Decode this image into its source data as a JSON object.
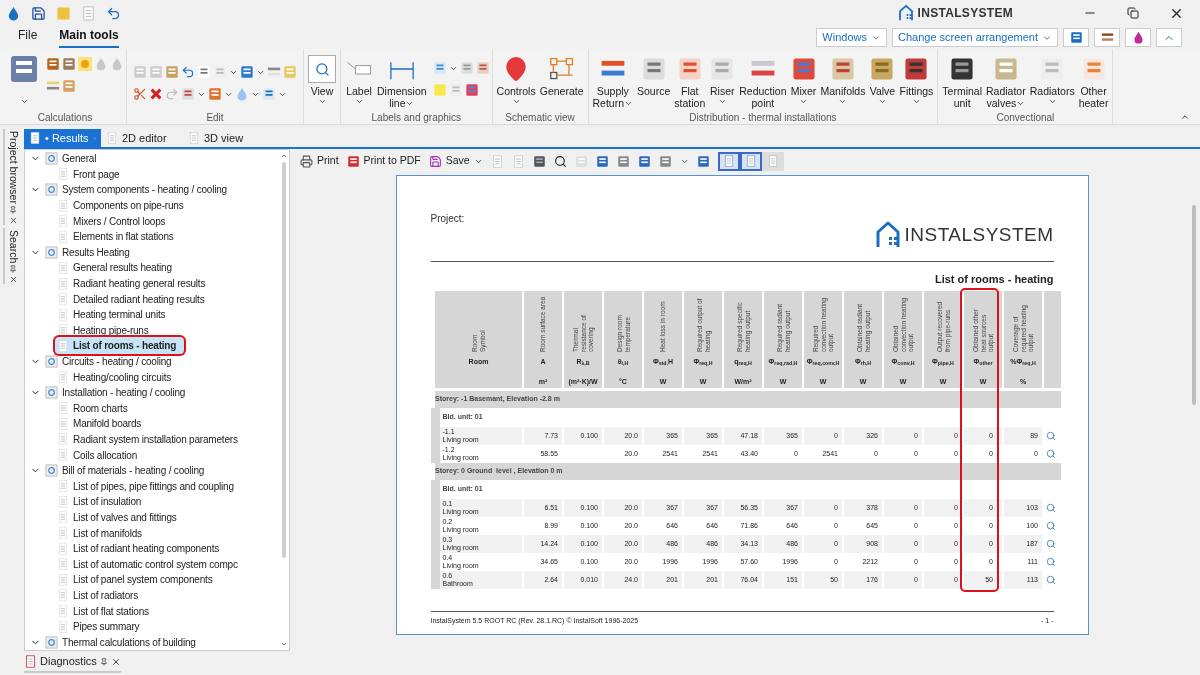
{
  "title_bar": {
    "logo": "INSTALSYSTEM"
  },
  "menu_tabs": [
    {
      "label": "File",
      "selected": false
    },
    {
      "label": "Main tools",
      "selected": true
    }
  ],
  "top_right": {
    "dropdowns": [
      "Windows",
      "Change screen arrangement"
    ]
  },
  "ribbon_groups": [
    {
      "label": "Calculations",
      "buttons": [
        {
          "dropdown": true
        }
      ]
    },
    {
      "label": "Edit"
    },
    {
      "buttons": [
        {
          "lines": [
            "View"
          ],
          "dropdown": true
        }
      ]
    },
    {
      "label": "Labels and graphics",
      "buttons": [
        {
          "lines": [
            "Label"
          ],
          "dropdown": true
        },
        {
          "lines": [
            "Dimension",
            "line"
          ],
          "dropdown": true,
          "caret_beside_text": true
        }
      ]
    },
    {
      "label": "Schematic view",
      "buttons": [
        {
          "lines": [
            "Controls"
          ],
          "dropdown": true
        },
        {
          "lines": [
            "Generate"
          ]
        }
      ]
    },
    {
      "label": "Distribution - thermal installations",
      "buttons": [
        {
          "lines": [
            "Supply",
            "Return"
          ],
          "dropdown": true,
          "caret_beside_text": true
        },
        {
          "lines": [
            "Source"
          ]
        },
        {
          "lines": [
            "Flat",
            "station"
          ]
        },
        {
          "lines": [
            "Riser"
          ],
          "dropdown": true
        },
        {
          "lines": [
            "Reduction",
            "point"
          ]
        },
        {
          "lines": [
            "Mixer"
          ],
          "dropdown": true
        },
        {
          "lines": [
            "Manifolds"
          ],
          "dropdown": true
        },
        {
          "lines": [
            "Valve"
          ],
          "dropdown": true
        },
        {
          "lines": [
            "Fittings"
          ],
          "dropdown": true
        }
      ]
    },
    {
      "label": "Convectional",
      "buttons": [
        {
          "lines": [
            "Terminal",
            "unit"
          ]
        },
        {
          "lines": [
            "Radiator",
            "valves"
          ],
          "dropdown": true,
          "caret_beside_text": true
        },
        {
          "lines": [
            "Radiators"
          ],
          "dropdown": true
        },
        {
          "lines": [
            "Other",
            "heater"
          ]
        }
      ]
    }
  ],
  "side_panels": [
    "Project browser",
    "Search"
  ],
  "doc_tabs": [
    {
      "label": "• Results",
      "selected": true
    },
    {
      "label": "2D editor",
      "selected": false
    },
    {
      "label": "3D view",
      "selected": false
    }
  ],
  "tree": [
    {
      "label": "General",
      "expanded": true,
      "children": [
        {
          "label": "Front page",
          "selected": false,
          "marked": false
        }
      ]
    },
    {
      "label": "System components - heating / cooling",
      "expanded": true,
      "children": [
        {
          "label": "Components on pipe-runs",
          "selected": false,
          "marked": false
        },
        {
          "label": "Mixers / Control loops",
          "selected": false,
          "marked": false
        },
        {
          "label": "Elements in flat stations",
          "selected": false,
          "marked": false
        }
      ]
    },
    {
      "label": "Results Heating",
      "expanded": true,
      "children": [
        {
          "label": "General results heating",
          "selected": false,
          "marked": false
        },
        {
          "label": "Radiant heating general results",
          "selected": false,
          "marked": false
        },
        {
          "label": "Detailed radiant heating results",
          "selected": false,
          "marked": false
        },
        {
          "label": "Heating terminal units",
          "selected": false,
          "marked": false
        },
        {
          "label": "Heating pipe-runs",
          "selected": false,
          "marked": false
        },
        {
          "label": "List of rooms - heating",
          "selected": true,
          "marked": true
        }
      ]
    },
    {
      "label": "Circuits - heating / cooling",
      "expanded": true,
      "children": [
        {
          "label": "Heating/cooling circuits",
          "selected": false,
          "marked": false
        }
      ]
    },
    {
      "label": "Installation - heating / cooling",
      "expanded": true,
      "children": [
        {
          "label": "Room charts",
          "selected": false,
          "marked": false
        },
        {
          "label": "Manifold boards",
          "selected": false,
          "marked": false
        },
        {
          "label": "Radiant system installation parameters",
          "selected": false,
          "marked": false
        },
        {
          "label": "Coils allocation",
          "selected": false,
          "marked": false
        }
      ]
    },
    {
      "label": "Bill of materials - heating / cooling",
      "expanded": true,
      "children": [
        {
          "label": "List of pipes, pipe fittings and coupling",
          "selected": false,
          "marked": false
        },
        {
          "label": "List of insulation",
          "selected": false,
          "marked": false
        },
        {
          "label": "List of valves and fittings",
          "selected": false,
          "marked": false
        },
        {
          "label": "List of manifolds",
          "selected": false,
          "marked": false
        },
        {
          "label": "List of radiant heating components",
          "selected": false,
          "marked": false
        },
        {
          "label": "List of automatic control system compc",
          "selected": false,
          "marked": false
        },
        {
          "label": "List of panel system components",
          "selected": false,
          "marked": false
        },
        {
          "label": "List of radiators",
          "selected": false,
          "marked": false
        },
        {
          "label": "List of flat stations",
          "selected": false,
          "marked": false
        },
        {
          "label": "Pipes summary",
          "selected": false,
          "marked": false
        }
      ]
    },
    {
      "label": "Thermal calculations of building",
      "expanded": true
    }
  ],
  "toolbar": {
    "buttons": [
      {
        "label": "Print"
      },
      {
        "label": "Print to PDF"
      },
      {
        "label": "Save",
        "dropdown": true
      }
    ],
    "page_view_buttons": [
      {
        "selected": true
      },
      {
        "selected": true
      },
      {
        "selected": false
      }
    ]
  },
  "report": {
    "project_label": "Project:",
    "logo": "INSTALSYSTEM",
    "title": "List of rooms - heating",
    "columns": [
      {
        "header": [
          "Room",
          "Symbol"
        ],
        "symbol": "Room",
        "highlighted": false
      },
      {
        "header": [
          "Room surface area"
        ],
        "symbol": "A",
        "unit": "m²",
        "highlighted": false
      },
      {
        "header": [
          "Thermal",
          "resistance of",
          "covering"
        ],
        "symbol": "R$_{λ,B}$",
        "unit": "(m²·K)/W",
        "highlighted": false
      },
      {
        "header": [
          "Design room",
          "temperature"
        ],
        "symbol": "θ$_{i,H}$",
        "unit": "°C",
        "highlighted": false
      },
      {
        "header": [
          "Heat loss in room"
        ],
        "symbol": "Φ$_{std,}$H",
        "unit": "W",
        "highlighted": false
      },
      {
        "header": [
          "Required output of",
          "heating"
        ],
        "symbol": "Φ$_{req,H}$",
        "unit": "W",
        "highlighted": false
      },
      {
        "header": [
          "Required specific",
          "heating output"
        ],
        "symbol": "q$_{req,H}$",
        "unit": "W/m²",
        "highlighted": false
      },
      {
        "header": [
          "Required radiant",
          "heating output"
        ],
        "symbol": "Φ$_{req,rad,H}$",
        "unit": "W",
        "highlighted": false
      },
      {
        "header": [
          "Required",
          "convection heating",
          "output"
        ],
        "symbol": "Φ$_{req,conv,H}$",
        "unit": "W",
        "highlighted": false
      },
      {
        "header": [
          "Obtained radiant",
          "heating output"
        ],
        "symbol": "Φ$_{rh,H}$",
        "unit": "W",
        "highlighted": false
      },
      {
        "header": [
          "Obtained",
          "convection heating",
          "output"
        ],
        "symbol": "Φ$_{conv,H}$",
        "unit": "W",
        "highlighted": false
      },
      {
        "header": [
          "Output recovered",
          "from pipe-runs"
        ],
        "symbol": "Φ$_{pipe,H}$",
        "unit": "W",
        "highlighted": false
      },
      {
        "header": [
          "Obtained other",
          "heat sources",
          "output"
        ],
        "symbol": "Φ$_{other}$",
        "unit": "W",
        "highlighted": true
      },
      {
        "header": [
          "Coverage of",
          "required heating",
          "output"
        ],
        "symbol": "%Φ$_{req,H}$",
        "unit": "%",
        "highlighted": false
      }
    ],
    "sections": [
      {
        "storey": "Storey: -1 Basemant, Elevation -2.8 m",
        "units": [
          {
            "label": "Bld. unit: 01",
            "rows": [
              {
                "symbol": "-1.1",
                "name": "Living room",
                "area": "7.73",
                "resistance": "0.100",
                "temperature": "20.0",
                "heat_loss": "365",
                "required": "365",
                "specific": "47.18",
                "required_radiant": "365",
                "required_convection": "0",
                "obtained_radiant": "326",
                "obtained_convection": "0",
                "recovered": "0",
                "other": "0",
                "coverage": "89"
              },
              {
                "symbol": "-1.2",
                "name": "Living room",
                "area": "58.55",
                "temperature": "20.0",
                "heat_loss": "2541",
                "required": "2541",
                "specific": "43.40",
                "required_radiant": "0",
                "required_convection": "2541",
                "obtained_radiant": "0",
                "obtained_convection": "0",
                "recovered": "0",
                "other": "0",
                "coverage": "0"
              }
            ]
          }
        ]
      },
      {
        "storey": "Storey: 0 Ground  level , Elevation 0 m",
        "units": [
          {
            "label": "Bld. unit: 01",
            "rows": [
              {
                "symbol": "0.1",
                "name": "Living room",
                "area": "6.51",
                "resistance": "0.100",
                "temperature": "20.0",
                "heat_loss": "367",
                "required": "367",
                "specific": "56.35",
                "required_radiant": "367",
                "required_convection": "0",
                "obtained_radiant": "378",
                "obtained_convection": "0",
                "recovered": "0",
                "other": "0",
                "coverage": "103"
              },
              {
                "symbol": "0.2",
                "name": "Living room",
                "area": "8.99",
                "resistance": "0.100",
                "temperature": "20.0",
                "heat_loss": "646",
                "required": "646",
                "specific": "71.86",
                "required_radiant": "646",
                "required_convection": "0",
                "obtained_radiant": "645",
                "obtained_convection": "0",
                "recovered": "0",
                "other": "0",
                "coverage": "100"
              },
              {
                "symbol": "0.3",
                "name": "Living room",
                "area": "14.24",
                "resistance": "0.100",
                "temperature": "20.0",
                "heat_loss": "486",
                "required": "486",
                "specific": "34.13",
                "required_radiant": "486",
                "required_convection": "0",
                "obtained_radiant": "908",
                "obtained_convection": "0",
                "recovered": "0",
                "other": "0",
                "coverage": "187"
              },
              {
                "symbol": "0.4",
                "name": "Living room",
                "area": "34.65",
                "resistance": "0.100",
                "temperature": "20.0",
                "heat_loss": "1996",
                "required": "1996",
                "specific": "57.60",
                "required_radiant": "1996",
                "required_convection": "0",
                "obtained_radiant": "2212",
                "obtained_convection": "0",
                "recovered": "0",
                "other": "0",
                "coverage": "111"
              },
              {
                "symbol": "0.6",
                "name": "Bathroom",
                "area": "2.64",
                "resistance": "0.010",
                "temperature": "24.0",
                "heat_loss": "201",
                "required": "201",
                "specific": "76.04",
                "required_radiant": "151",
                "required_convection": "50",
                "obtained_radiant": "176",
                "obtained_convection": "0",
                "recovered": "0",
                "other": "50",
                "coverage": "113"
              }
            ]
          }
        ]
      }
    ],
    "footer": "InstalSystem 5.5 ROOT RC (Rev. 28.1.RC) © InstalSoft 1996-2025",
    "page": "- 1 -"
  },
  "diagnostics": {
    "label": "Diagnostics"
  }
}
